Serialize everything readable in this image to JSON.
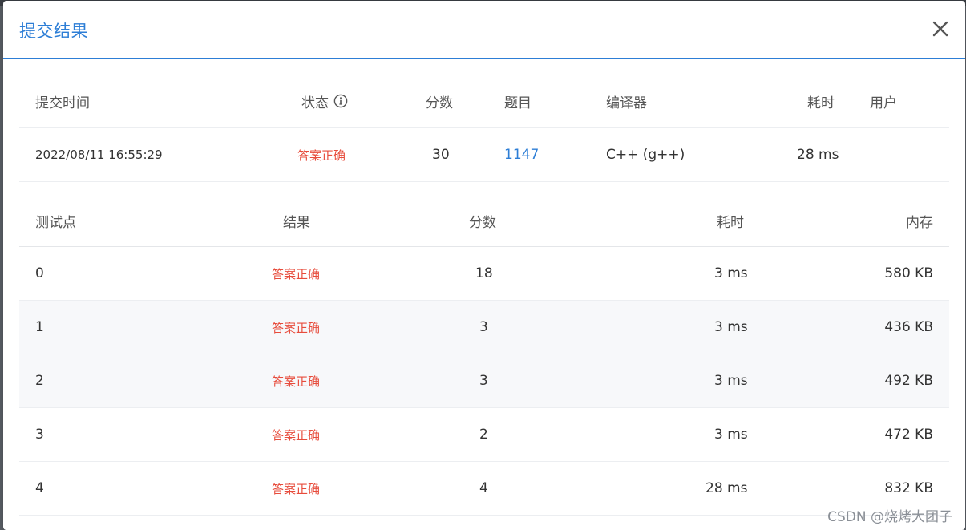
{
  "dialog": {
    "title": "提交结果",
    "close_icon": "close-icon"
  },
  "summary": {
    "headers": {
      "submit_time": "提交时间",
      "status": "状态",
      "score": "分数",
      "problem": "题目",
      "compiler": "编译器",
      "time": "耗时",
      "user": "用户"
    },
    "row": {
      "submit_time": "2022/08/11 16:55:29",
      "status": "答案正确",
      "score": "30",
      "problem": "1147",
      "compiler": "C++ (g++)",
      "time": "28 ms",
      "user": ""
    }
  },
  "cases": {
    "headers": {
      "case": "测试点",
      "result": "结果",
      "score": "分数",
      "time": "耗时",
      "memory": "内存"
    },
    "rows": [
      {
        "case": "0",
        "result": "答案正确",
        "score": "18",
        "time": "3 ms",
        "memory": "580 KB"
      },
      {
        "case": "1",
        "result": "答案正确",
        "score": "3",
        "time": "3 ms",
        "memory": "436 KB"
      },
      {
        "case": "2",
        "result": "答案正确",
        "score": "3",
        "time": "3 ms",
        "memory": "492 KB"
      },
      {
        "case": "3",
        "result": "答案正确",
        "score": "2",
        "time": "3 ms",
        "memory": "472 KB"
      },
      {
        "case": "4",
        "result": "答案正确",
        "score": "4",
        "time": "28 ms",
        "memory": "832 KB"
      }
    ]
  },
  "watermark": "CSDN @烧烤大团子",
  "colors": {
    "accent": "#2d7ed6",
    "success_text": "#e74c3c"
  }
}
